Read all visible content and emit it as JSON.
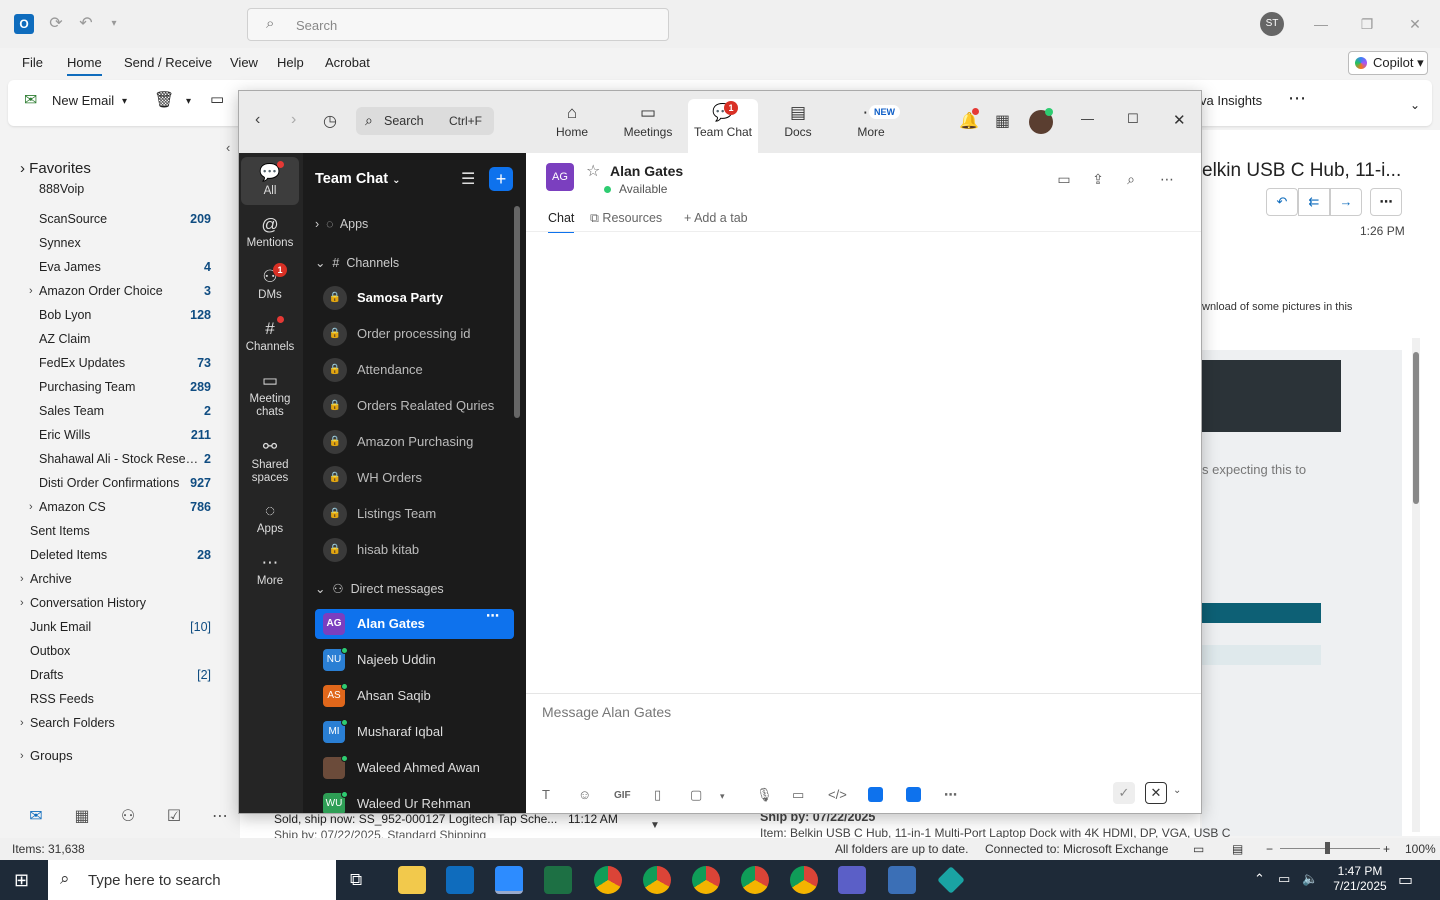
{
  "outlook": {
    "search_placeholder": "Search",
    "user_initials": "ST",
    "menu": [
      "File",
      "Home",
      "Send / Receive",
      "View",
      "Help",
      "Acrobat"
    ],
    "copilot": "Copilot",
    "ribbon": {
      "new_email": "New Email",
      "insights": "va Insights"
    },
    "favorites": "Favorites",
    "folders": [
      {
        "name": "888Voip",
        "count": ""
      },
      {
        "name": "ScanSource",
        "count": "209"
      },
      {
        "name": "Synnex",
        "count": ""
      },
      {
        "name": "Eva James",
        "count": "4"
      },
      {
        "name": "Amazon Order Choice",
        "count": "3"
      },
      {
        "name": "Bob Lyon",
        "count": "128"
      },
      {
        "name": "AZ Claim",
        "count": ""
      },
      {
        "name": "FedEx Updates",
        "count": "73"
      },
      {
        "name": "Purchasing Team",
        "count": "289"
      },
      {
        "name": "Sales Team",
        "count": "2"
      },
      {
        "name": "Eric Wills",
        "count": "211"
      },
      {
        "name": "Shahawal Ali - Stock Reserv...",
        "count": "2"
      },
      {
        "name": "Disti Order Confirmations",
        "count": "927"
      },
      {
        "name": "Amazon CS",
        "count": "786"
      },
      {
        "name": "Sent Items",
        "count": ""
      },
      {
        "name": "Deleted Items",
        "count": "28"
      },
      {
        "name": "Archive",
        "count": ""
      },
      {
        "name": "Conversation History",
        "count": ""
      },
      {
        "name": "Junk Email",
        "count": "[10]"
      },
      {
        "name": "Outbox",
        "count": ""
      },
      {
        "name": "Drafts",
        "count": "[2]"
      },
      {
        "name": "RSS Feeds",
        "count": ""
      },
      {
        "name": "Search Folders",
        "count": ""
      }
    ],
    "groups": "Groups",
    "reading": {
      "subject": "elkin USB C Hub, 11-i...",
      "time": "1:26 PM",
      "notice": "wnload of some pictures in this",
      "body1": "s expecting this to",
      "ship_by": "Ship by: 07/22/2025",
      "item": "Item: Belkin USB C Hub, 11-in-1 Multi-Port Laptop Dock with 4K HDMI, DP, VGA, USB C"
    },
    "list_item": {
      "title": "Sold, ship now: SS_952-000127 Logitech Tap Sche...",
      "time": "11:12 AM",
      "sub": "Ship by: 07/22/2025, Standard Shipping"
    },
    "status": {
      "items": "Items: 31,638",
      "sync": "All folders are up to date.",
      "conn": "Connected to: Microsoft Exchange",
      "zoom": "100%"
    }
  },
  "taskbar": {
    "search": "Type here to search",
    "time": "1:47 PM",
    "date": "7/21/2025"
  },
  "zoom": {
    "search": "Search",
    "shortcut": "Ctrl+F",
    "tabs": [
      "Home",
      "Meetings",
      "Team Chat",
      "Docs",
      "More"
    ],
    "team_chat_badge": "1",
    "new_badge": "NEW",
    "rail": [
      "All",
      "Mentions",
      "DMs",
      "Channels",
      "Meeting chats",
      "Shared spaces",
      "Apps",
      "More"
    ],
    "dms_badge": "1",
    "sidebar_title": "Team Chat",
    "apps": "Apps",
    "channels_label": "Channels",
    "channels": [
      "Samosa Party",
      "Order processing id",
      "Attendance",
      "Orders Realated Quries",
      "Amazon Purchasing",
      "WH Orders",
      "Listings Team",
      "hisab kitab"
    ],
    "dm_label": "Direct messages",
    "dms": [
      {
        "initials": "AG",
        "name": "Alan Gates",
        "color": "#7b3fbf"
      },
      {
        "initials": "NU",
        "name": "Najeeb Uddin",
        "color": "#2a7fd4"
      },
      {
        "initials": "AS",
        "name": "Ahsan Saqib",
        "color": "#e0671b"
      },
      {
        "initials": "MI",
        "name": "Musharaf Iqbal",
        "color": "#2a7fd4"
      },
      {
        "initials": "",
        "name": "Waleed Ahmed Awan",
        "color": "#6b4b3a"
      },
      {
        "initials": "WU",
        "name": "Waleed Ur Rehman",
        "color": "#2e9e55"
      }
    ],
    "chat": {
      "initials": "AG",
      "name": "Alan Gates",
      "status": "Available",
      "tabs": [
        "Chat",
        "Resources",
        "Add a tab"
      ],
      "placeholder": "Message Alan Gates"
    }
  }
}
